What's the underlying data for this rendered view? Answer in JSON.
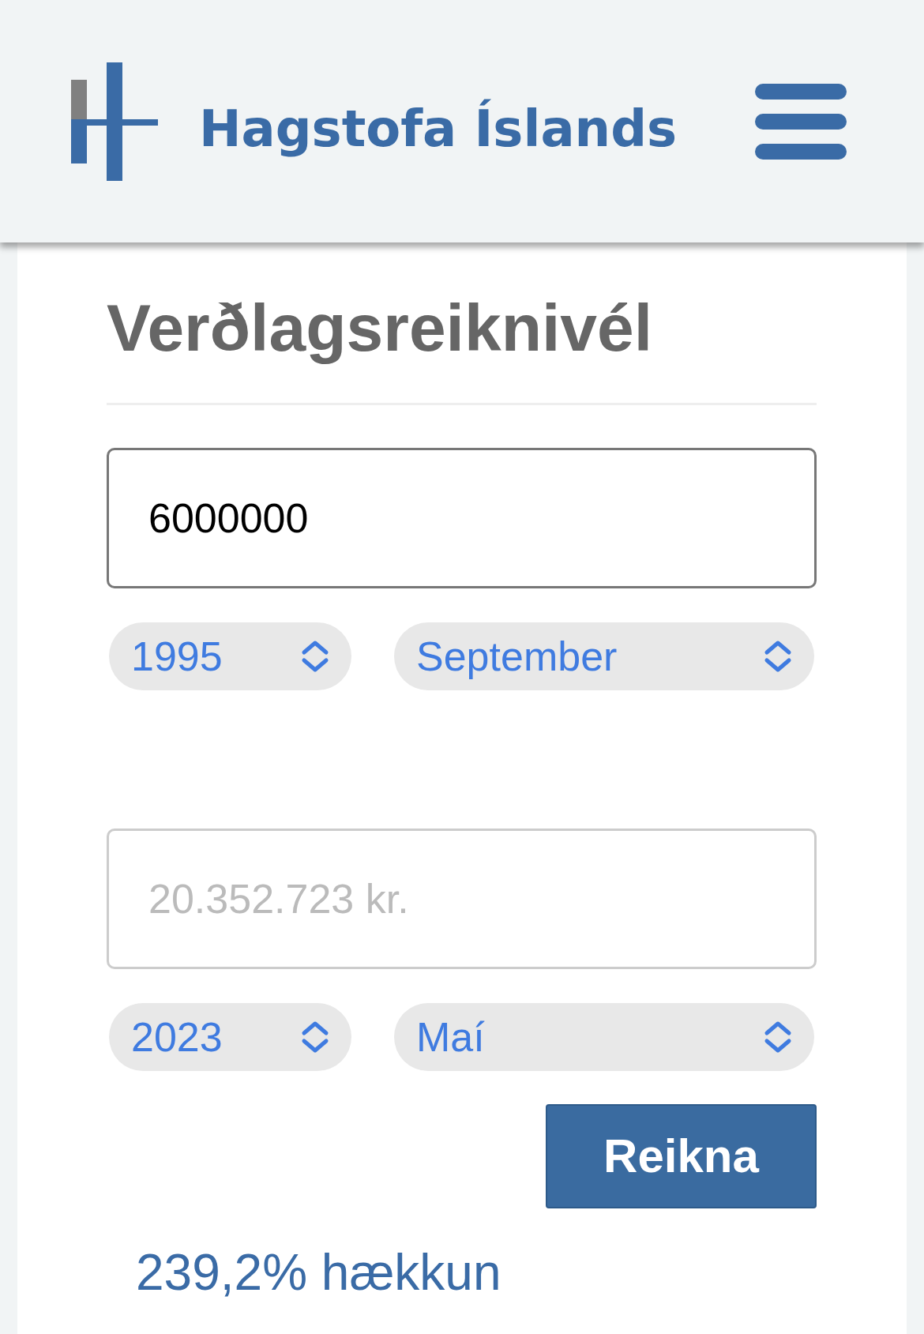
{
  "header": {
    "title": "Hagstofa Íslands"
  },
  "calculator": {
    "heading": "Verðlagsreiknivél",
    "amount": {
      "value": "6000000"
    },
    "from": {
      "year": "1995",
      "month": "September"
    },
    "result": {
      "placeholder": "20.352.723 kr."
    },
    "to": {
      "year": "2023",
      "month": "Maí"
    },
    "button": "Reikna",
    "change": "239,2% hækkun"
  }
}
